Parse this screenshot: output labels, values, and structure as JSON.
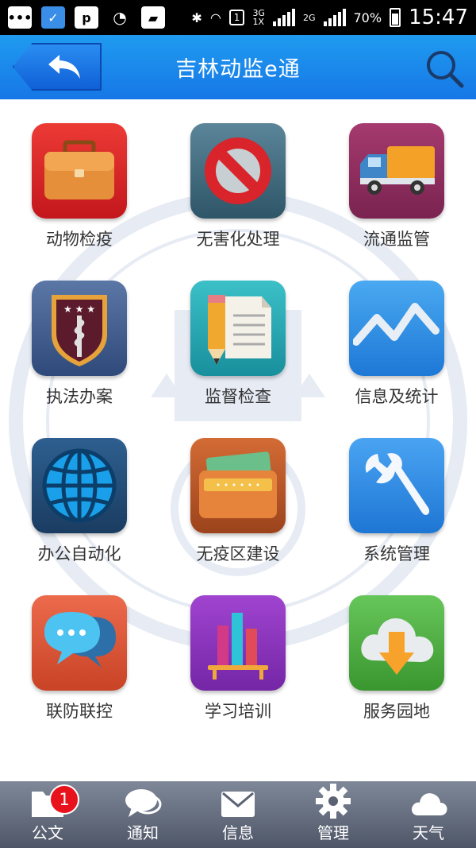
{
  "status_bar": {
    "battery": "70%",
    "time": "15:47",
    "network": "3G",
    "network2": "1X",
    "network3": "2G",
    "sim": "1"
  },
  "header": {
    "title": "吉林动监e通",
    "back_icon": "back-arrow-icon",
    "search_icon": "search-icon"
  },
  "grid": {
    "items": [
      {
        "label": "动物检疫",
        "icon": "briefcase-icon",
        "color": "#d9262b"
      },
      {
        "label": "无害化处理",
        "icon": "prohibited-icon",
        "color": "#3f6b80"
      },
      {
        "label": "流通监管",
        "icon": "truck-icon",
        "color": "#8f2b5e"
      },
      {
        "label": "执法办案",
        "icon": "law-badge-icon",
        "color": "#3d5a86"
      },
      {
        "label": "监督检查",
        "icon": "pencil-document-icon",
        "color": "#1fa6b3"
      },
      {
        "label": "信息及统计",
        "icon": "line-chart-icon",
        "color": "#2f8ee5"
      },
      {
        "label": "办公自动化",
        "icon": "globe-icon",
        "color": "#24517e"
      },
      {
        "label": "无疫区建设",
        "icon": "folder-icon",
        "color": "#b9582a"
      },
      {
        "label": "系统管理",
        "icon": "wrench-icon",
        "color": "#2c8fe7"
      },
      {
        "label": "联防联控",
        "icon": "chat-bubbles-icon",
        "color": "#e25a3d"
      },
      {
        "label": "学习培训",
        "icon": "bookshelf-icon",
        "color": "#8a36b9"
      },
      {
        "label": "服务园地",
        "icon": "cloud-download-icon",
        "color": "#4fb04a"
      }
    ]
  },
  "bottom_nav": {
    "items": [
      {
        "label": "公文",
        "icon": "folder-icon",
        "badge": "1"
      },
      {
        "label": "通知",
        "icon": "chat-icon"
      },
      {
        "label": "信息",
        "icon": "mail-icon"
      },
      {
        "label": "管理",
        "icon": "gear-icon"
      },
      {
        "label": "天气",
        "icon": "cloud-icon"
      }
    ]
  }
}
